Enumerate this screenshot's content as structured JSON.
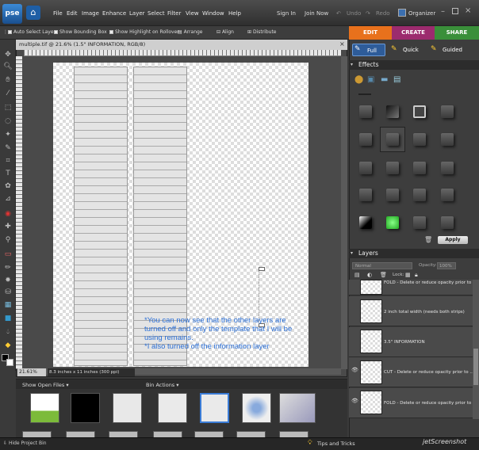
{
  "app": {
    "logo": "pse",
    "home_icon": "home-icon"
  },
  "menu": [
    "File",
    "Edit",
    "Image",
    "Enhance",
    "Layer",
    "Select",
    "Filter",
    "View",
    "Window",
    "Help"
  ],
  "top_actions": {
    "sign_in": "Sign In",
    "join_now": "Join Now",
    "undo": "Undo",
    "redo": "Redo",
    "organizer": "Organizer"
  },
  "options_bar": {
    "auto_select": "Auto Select Layer",
    "show_bounding": "Show Bounding Box",
    "show_highlight": "Show Highlight on Rollover",
    "arrange": "Arrange",
    "align": "Align",
    "distribute": "Distribute"
  },
  "tabs": {
    "edit": "EDIT",
    "create": "CREATE",
    "share": "SHARE"
  },
  "colors": {
    "edit_tab": "#e8711c",
    "create_tab": "#9c2b6e",
    "share_tab": "#3a8f3a",
    "annotation": "#2b6fd6",
    "accent": "#1e5ea5"
  },
  "edit_modes": {
    "full": "Full",
    "quick": "Quick",
    "guided": "Guided"
  },
  "document": {
    "title": "multiple.tif @ 21.6% (1.5\" INFORMATION, RGB/8)",
    "zoom": "21.61%",
    "size": "8.3 inches x 11 inches (300 ppi)"
  },
  "annotation": {
    "line1": "*You can now see that the other layers are",
    "line2": "turned off and only the template that I will be",
    "line3": "using remains.",
    "line4": "*I also turned off the information layer"
  },
  "project_bin": {
    "show": "Show Open Files",
    "actions": "Bin Actions",
    "hide": "Hide Project Bin"
  },
  "effects": {
    "title": "Effects",
    "apply": "Apply"
  },
  "layers": {
    "title": "Layers",
    "blend_mode": "Normal",
    "opacity_label": "Opacity:",
    "opacity_value": "100%",
    "lock_label": "Lock:",
    "items": [
      {
        "name": "FOLD - Delete or reduce opacity prior to ...",
        "visible": false
      },
      {
        "name": "2 inch total width (needs both strips)",
        "visible": false
      },
      {
        "name": "3.5\" INFORMATION",
        "visible": false
      },
      {
        "name": "CUT - Delete or reduce opacity prior to ...",
        "visible": true
      },
      {
        "name": "FOLD - Delete or reduce opacity prior to ...",
        "visible": true
      }
    ]
  },
  "status": {
    "tips": "Tips and Tricks",
    "watermark": "jetScreenshot"
  }
}
